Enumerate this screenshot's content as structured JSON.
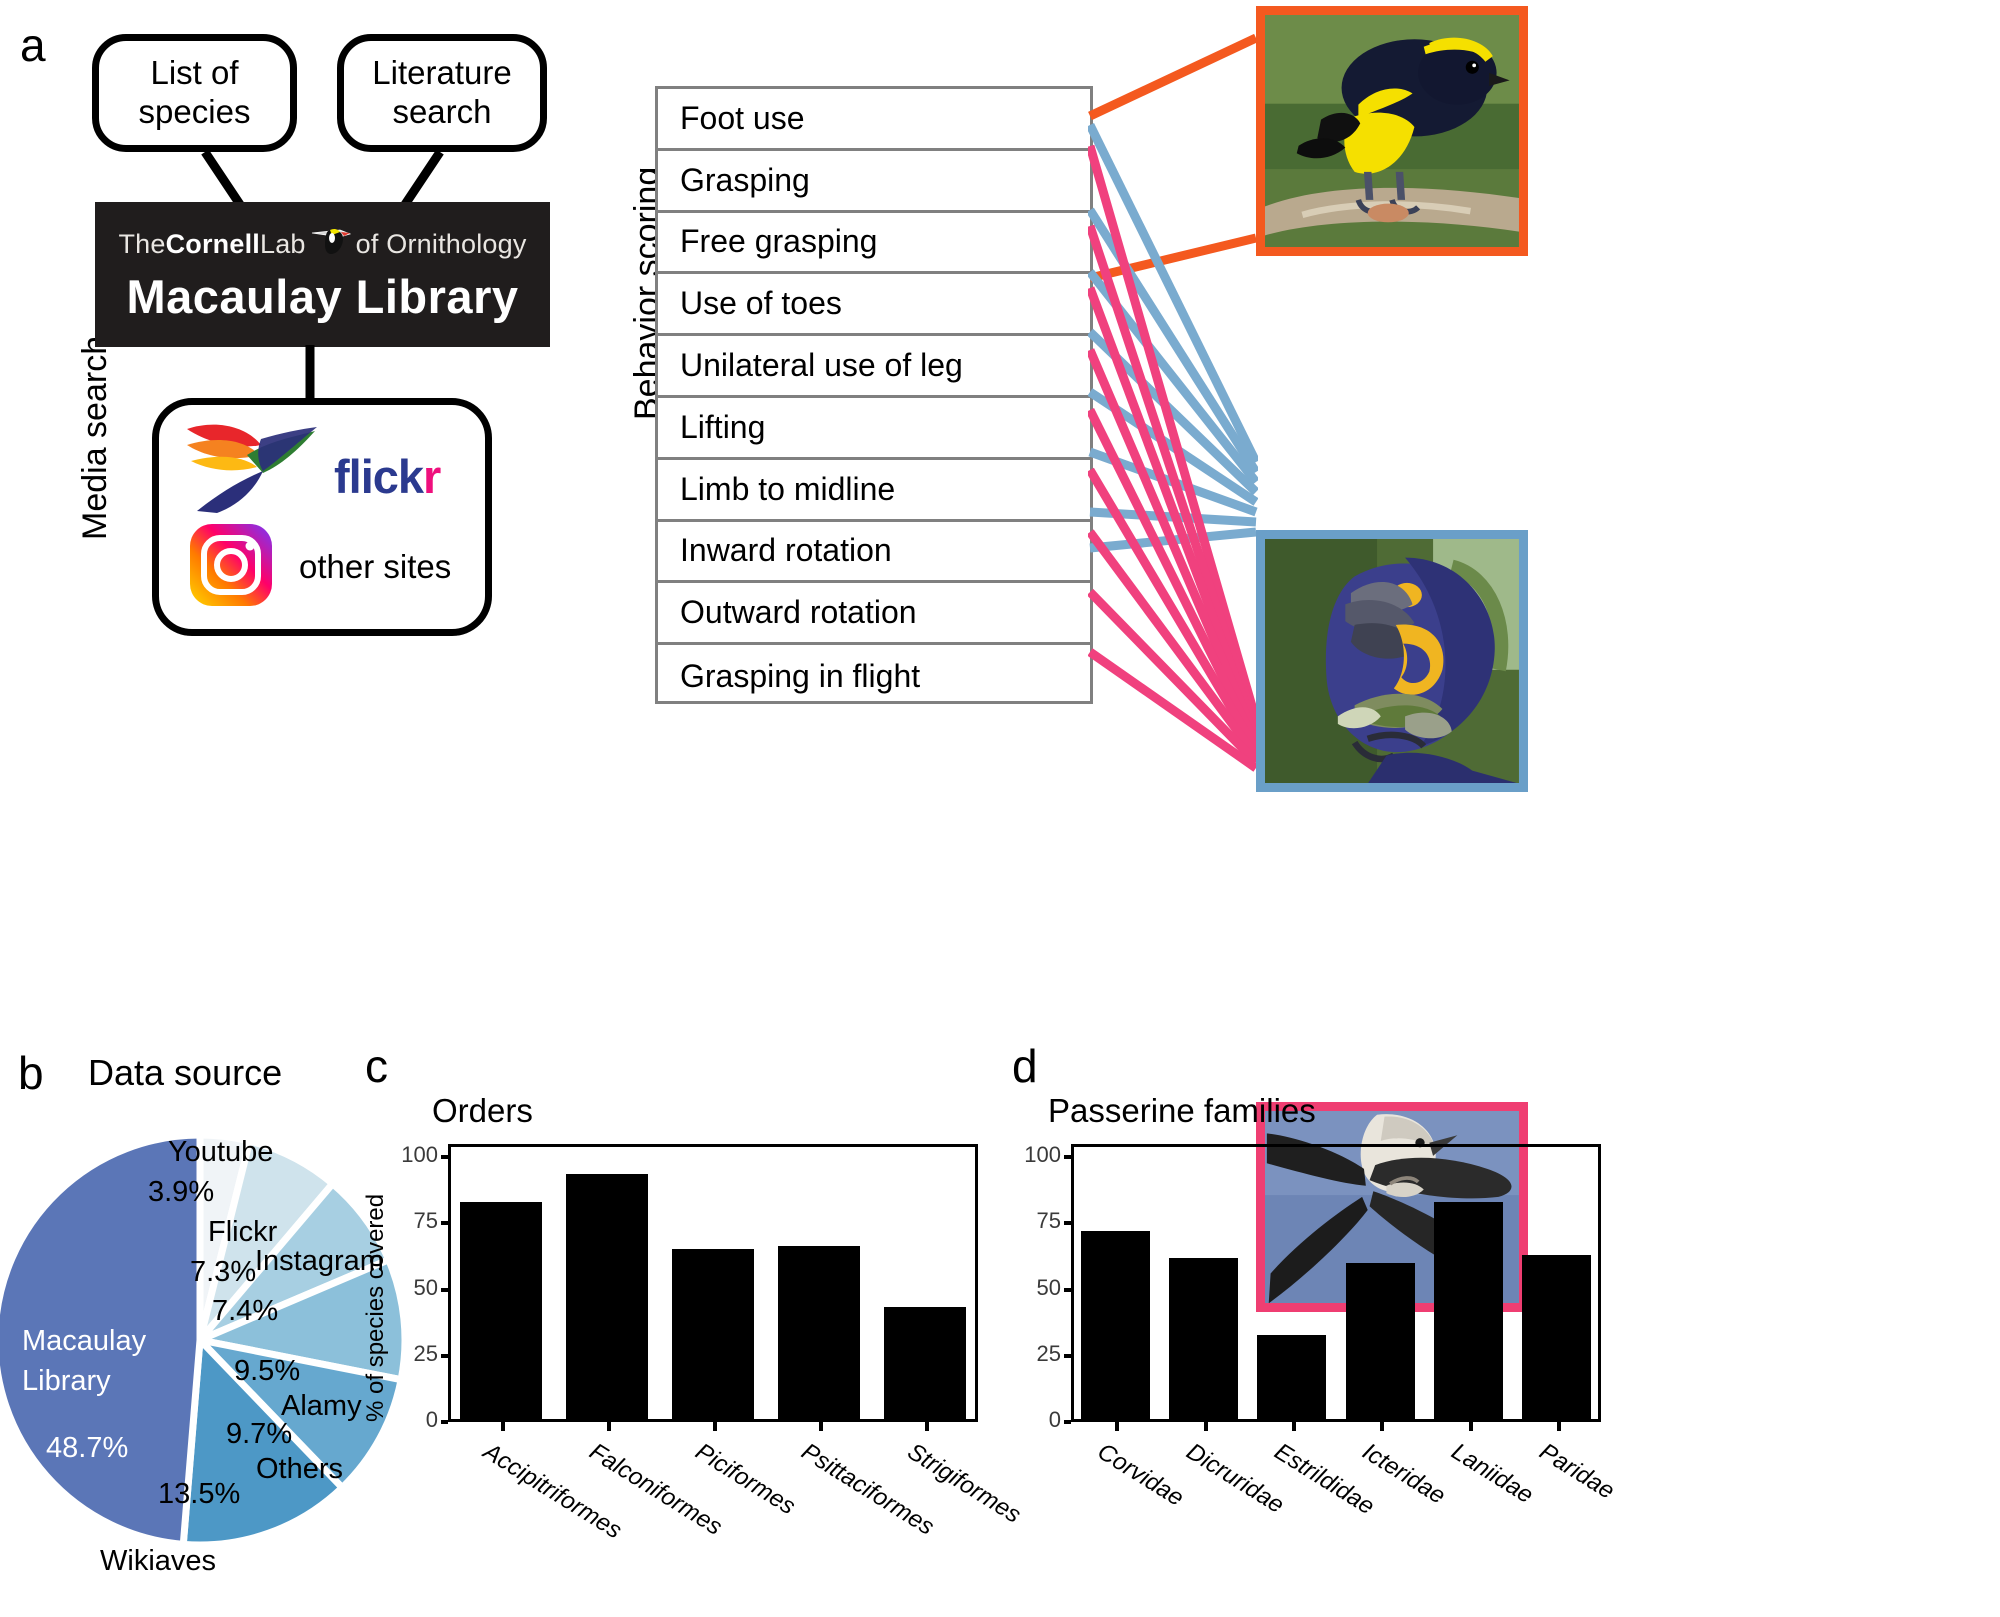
{
  "panels": {
    "a": {
      "letter": "a"
    },
    "b": {
      "letter": "b",
      "title": "Data source"
    },
    "c": {
      "letter": "c",
      "title": "Orders"
    },
    "d": {
      "letter": "d",
      "title": "Passerine families"
    }
  },
  "flow": {
    "side_label_media_search": "Media search",
    "side_label_behavior_scoring": "Behavior scoring",
    "node_list_of_species": "List of\nspecies",
    "node_literature_search": "Literature\nsearch",
    "macaulay": {
      "line1_the": "The",
      "line1_cornell": "Cornell",
      "line1_lab": "Lab",
      "line1_of_ornithology": "of Ornithology",
      "line2": "Macaulay Library",
      "bg": "#201d1d"
    },
    "flickr": {
      "part1": "flick",
      "part2": "r"
    },
    "other_sites": "other sites",
    "behaviors": [
      "Foot use",
      "Grasping",
      "Free grasping",
      "Use of toes",
      "Unilateral use of leg",
      "Lifting",
      "Limb to midline",
      "Inward rotation",
      "Outward rotation",
      "Grasping in flight"
    ],
    "photos": [
      {
        "name": "orange-framed-tanager-photo",
        "border": "#f4591f"
      },
      {
        "name": "blue-framed-macaw-photo",
        "border": "#6a9fc8"
      },
      {
        "name": "pink-framed-swallow-photo",
        "border": "#ef3e72"
      }
    ],
    "connector_colors": {
      "orange": "#f4591f",
      "blue": "#7aabcf",
      "pink": "#f0417e"
    }
  },
  "chart_data": [
    {
      "type": "pie",
      "title": "Data source",
      "categories": [
        "Macaulay Library",
        "Wikiaves",
        "Others",
        "Alamy",
        "Instagram",
        "Flickr",
        "Youtube"
      ],
      "values": [
        48.7,
        13.5,
        9.7,
        9.5,
        7.4,
        7.3,
        3.9
      ],
      "labels": [
        "48.7%",
        "13.5%",
        "9.7%",
        "9.5%",
        "7.4%",
        "7.3%",
        "3.9%"
      ],
      "colors": [
        "#5b76b7",
        "#4d98c6",
        "#66a8cf",
        "#8cc0da",
        "#a7cfe2",
        "#cfe3ec",
        "#f0f4f7"
      ],
      "legend": "inline-labels"
    },
    {
      "type": "bar",
      "title": "Orders",
      "categories": [
        "Accipitriformes",
        "Falconiformes",
        "Piciformes",
        "Psittaciformes",
        "Strigiformes"
      ],
      "values": [
        83,
        93.5,
        65.5,
        66.5,
        43.5
      ],
      "xlabel": "",
      "ylabel": "% of species covered",
      "ylim": [
        0,
        105
      ],
      "yticks": [
        0,
        25,
        50,
        75,
        100
      ],
      "grid": false,
      "bar_color": "#000000"
    },
    {
      "type": "bar",
      "title": "Passerine families",
      "categories": [
        "Corvidae",
        "Dicruridae",
        "Estrildidae",
        "Icteridae",
        "Laniidae",
        "Paridae"
      ],
      "values": [
        72,
        62,
        33,
        60,
        83,
        63
      ],
      "xlabel": "",
      "ylabel": "",
      "ylim": [
        0,
        105
      ],
      "yticks": [
        0,
        25,
        50,
        75,
        100
      ],
      "grid": false,
      "bar_color": "#000000"
    }
  ]
}
